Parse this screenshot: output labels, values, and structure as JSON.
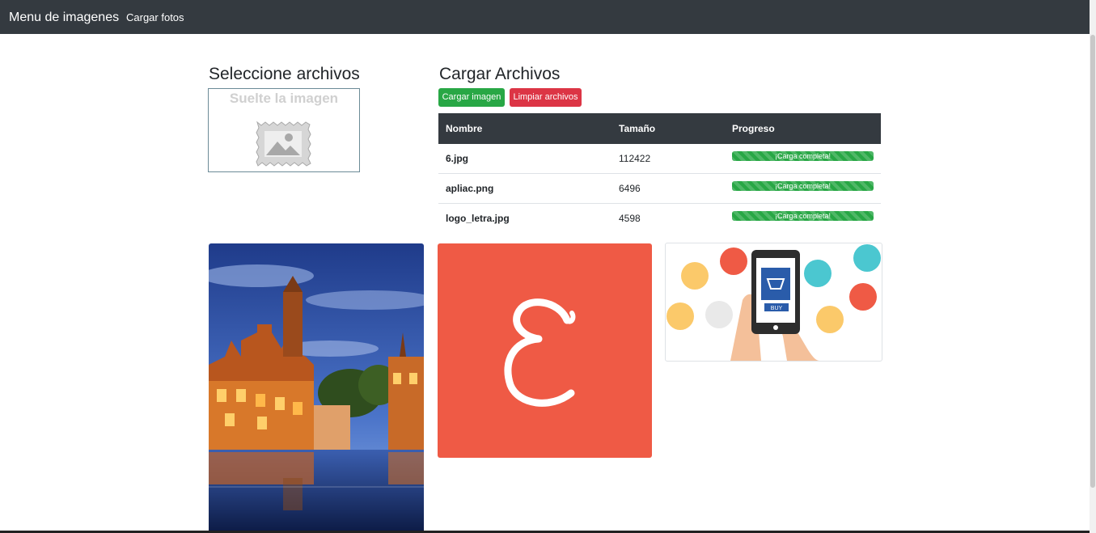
{
  "navbar": {
    "brand": "Menu de imagenes",
    "link": "Cargar fotos"
  },
  "select_section": {
    "title": "Seleccione archivos",
    "drop_text": "Suelte la imagen",
    "drop_icon": "image-placeholder-icon"
  },
  "upload_section": {
    "title": "Cargar Archivos",
    "upload_button": "Cargar imagen",
    "clear_button": "Limpiar archivos",
    "table": {
      "headers": [
        "Nombre",
        "Tamaño",
        "Progreso"
      ],
      "rows": [
        {
          "name": "6.jpg",
          "size": "112422",
          "progress_text": "¡Carga completa!",
          "progress": 100
        },
        {
          "name": "apliac.png",
          "size": "6496",
          "progress_text": "¡Carga completa!",
          "progress": 100
        },
        {
          "name": "logo_letra.jpg",
          "size": "4598",
          "progress_text": "¡Carga completa!",
          "progress": 100
        }
      ]
    }
  },
  "gallery": {
    "images": [
      {
        "name": "city-canal-photo"
      },
      {
        "name": "letter-e-logo",
        "letter": "E",
        "color": "#ef5a45"
      },
      {
        "name": "mobile-shopping-illustration",
        "buy_label": "BUY"
      }
    ]
  },
  "colors": {
    "navbar": "#343a40",
    "success": "#28a745",
    "danger": "#dc3545",
    "logo_bg": "#ef5a45"
  }
}
